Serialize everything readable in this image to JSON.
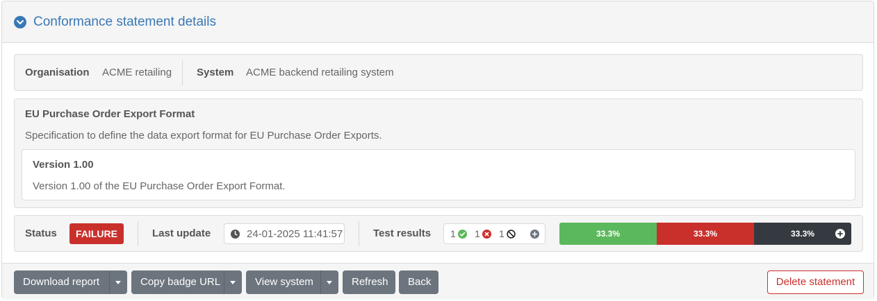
{
  "header": {
    "title": "Conformance statement details"
  },
  "party": {
    "organisation_label": "Organisation",
    "organisation_value": "ACME retailing",
    "system_label": "System",
    "system_value": "ACME backend retailing system"
  },
  "specification": {
    "title": "EU Purchase Order Export Format",
    "description": "Specification to define the data export format for EU Purchase Order Exports.",
    "version_title": "Version 1.00",
    "version_description": "Version 1.00 of the EU Purchase Order Export Format."
  },
  "status": {
    "status_label": "Status",
    "status_value": "FAILURE",
    "last_update_label": "Last update",
    "last_update_value": "24-01-2025 11:41:57",
    "test_results_label": "Test results",
    "passed_count": "1",
    "failed_count": "1",
    "undefined_count": "1",
    "bar": [
      {
        "label": "33.3%",
        "fraction": 0.333,
        "color": "#5cb85c"
      },
      {
        "label": "33.3%",
        "fraction": 0.333,
        "color": "#c9302c"
      },
      {
        "label": "33.3%",
        "fraction": 0.334,
        "color": "#343a40"
      }
    ]
  },
  "colors": {
    "accent": "#3a78b5",
    "success": "#5cb85c",
    "danger": "#c9302c",
    "dark": "#343a40",
    "secondary_button": "#6c757d"
  },
  "icons": {
    "header_toggle": "chevron-down-icon",
    "last_update": "clock-icon",
    "passed": "check-circle-icon",
    "failed": "times-circle-icon",
    "undefined": "ban-icon",
    "bar_expand": "plus-circle-icon"
  },
  "actions": {
    "download_report": "Download report",
    "copy_badge_url": "Copy badge URL",
    "view_system": "View system",
    "refresh": "Refresh",
    "back": "Back",
    "delete_statement": "Delete statement"
  }
}
